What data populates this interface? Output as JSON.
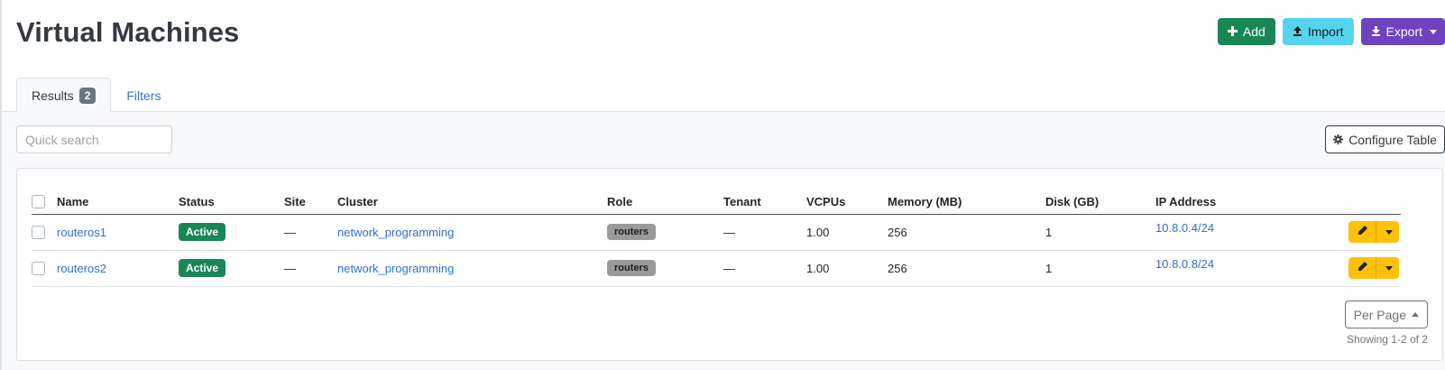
{
  "page": {
    "title": "Virtual Machines"
  },
  "actions": {
    "add_label": "Add",
    "import_label": "Import",
    "export_label": "Export"
  },
  "tabs": [
    {
      "label": "Results",
      "badge": "2",
      "active": true
    },
    {
      "label": "Filters",
      "active": false
    }
  ],
  "toolbar": {
    "search_placeholder": "Quick search",
    "configure_label": "Configure Table"
  },
  "table": {
    "columns": [
      "Name",
      "Status",
      "Site",
      "Cluster",
      "Role",
      "Tenant",
      "VCPUs",
      "Memory (MB)",
      "Disk (GB)",
      "IP Address"
    ],
    "rows": [
      {
        "name": "routeros1",
        "status": "Active",
        "site": "—",
        "cluster": "network_programming",
        "role": "routers",
        "tenant": "—",
        "vcpus": "1.00",
        "memory": "256",
        "disk": "1",
        "ip": "10.8.0.4/24"
      },
      {
        "name": "routeros2",
        "status": "Active",
        "site": "—",
        "cluster": "network_programming",
        "role": "routers",
        "tenant": "—",
        "vcpus": "1.00",
        "memory": "256",
        "disk": "1",
        "ip": "10.8.0.8/24"
      }
    ]
  },
  "pagination": {
    "per_page_label": "Per Page",
    "showing_text": "Showing 1-2 of 2"
  },
  "colors": {
    "add": "#198754",
    "import": "#56d4ee",
    "export": "#6f42c1",
    "status_active": "#198754",
    "role_badge": "#9a9a9a",
    "edit_button": "#ffc107",
    "link": "#2f6fd1"
  },
  "icons": {
    "add": "plus-icon",
    "import": "upload-icon",
    "export": "download-icon",
    "configure": "gear-icon",
    "edit": "pencil-icon"
  }
}
